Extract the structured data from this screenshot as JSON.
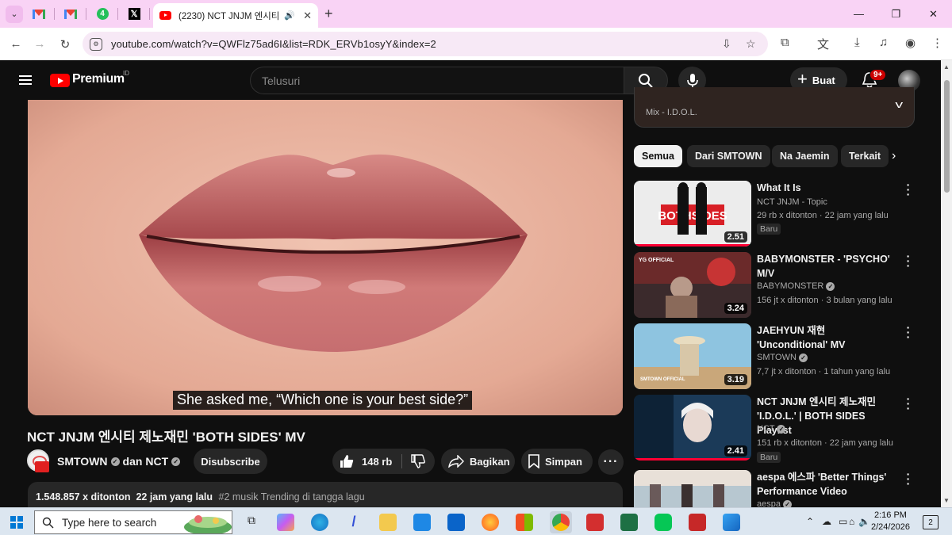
{
  "browser": {
    "pinned_tabs": [
      {
        "name": "gmail-tab-1"
      },
      {
        "name": "gmail-tab-2"
      },
      {
        "name": "whatsapp-tab",
        "glyph": "4"
      },
      {
        "name": "x-tab",
        "glyph": "𝕏"
      }
    ],
    "active_tab_title": "(2230) NCT JNJM 엔시티 제노재민 'BOTH SIDES' MV",
    "url": "youtube.com/watch?v=QWFlz75ad6I&list=RDK_ERVb1osyY&index=2"
  },
  "youtube": {
    "brand": "Premium",
    "region": "ID",
    "search_placeholder": "Telusuri",
    "create_label": "Buat",
    "notification_count": "9+"
  },
  "video": {
    "caption": "She asked me, “Which one is your best side?”",
    "title": "NCT JNJM 엔시티 제노재민 'BOTH SIDES' MV",
    "channel": "SMTOWN",
    "collab_joiner": "dan",
    "collab_channel": "NCT",
    "subscribe_label": "Disubscribe",
    "likes": "148 rb",
    "share_label": "Bagikan",
    "save_label": "Simpan",
    "views": "1.548.857 x ditonton",
    "age": "22 jam yang lalu",
    "trending": "#2 musik Trending di tangga lagu"
  },
  "sidebar": {
    "mix_subtitle": "Mix - I.D.O.L.",
    "chips": [
      "Semua",
      "Dari SMTOWN",
      "Na Jaemin",
      "Terkait"
    ],
    "recommendations": [
      {
        "title": "What It Is",
        "channel": "NCT JNJM - Topic",
        "verified": false,
        "meta": "29 rb x ditonton · 22 jam yang lalu",
        "duration": "2.51",
        "badge": "Baru",
        "thumb_text": "BOTHSIDES"
      },
      {
        "title": "BABYMONSTER - 'PSYCHO' M/V",
        "channel": "BABYMONSTER",
        "verified": true,
        "meta": "156 jt x ditonton · 3 bulan yang lalu",
        "duration": "3.24",
        "badge": "",
        "thumb_text": "YG OFFICIAL"
      },
      {
        "title": "JAEHYUN 재현 'Unconditional' MV",
        "channel": "SMTOWN",
        "verified": true,
        "meta": "7,7 jt x ditonton · 1 tahun yang lalu",
        "duration": "3.19",
        "badge": "",
        "thumb_text": "SMTOWN OFFICIAL"
      },
      {
        "title": "NCT JNJM 엔시티 제노재민 'I.D.O.L.' | BOTH SIDES Playlist",
        "channel": "NCT",
        "verified": true,
        "meta": "151 rb x ditonton · 22 jam yang lalu",
        "duration": "2.41",
        "badge": "Baru",
        "thumb_text": ""
      },
      {
        "title": "aespa 에스파 'Better Things' Performance Video",
        "channel": "aespa",
        "verified": true,
        "meta": "",
        "duration": "",
        "badge": "",
        "thumb_text": ""
      }
    ]
  },
  "taskbar": {
    "search_placeholder": "Type here to search",
    "time": "2:16 PM",
    "date": "2/24/2026",
    "notification_count": "2"
  }
}
